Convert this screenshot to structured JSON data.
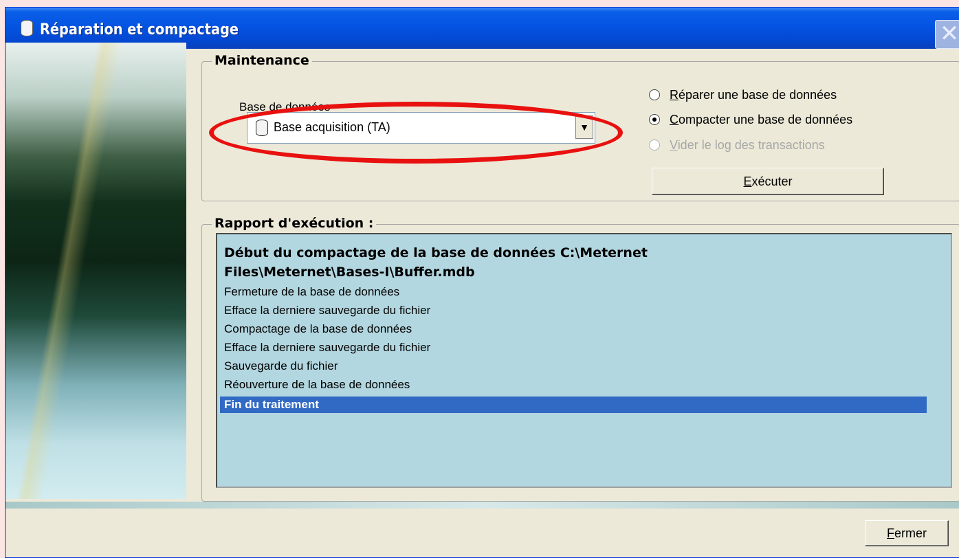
{
  "window": {
    "title": "Réparation et compactage",
    "close_glyph": "✕"
  },
  "maintenance": {
    "group_label": "Maintenance",
    "db_label": "Base de données",
    "selected_db": "Base acquisition (TA)",
    "dropdown_arrow": "▼",
    "options": [
      {
        "key": "R",
        "rest": "éparer une base de données",
        "checked": false,
        "enabled": true
      },
      {
        "key": "C",
        "rest": "ompacter une base de données",
        "checked": true,
        "enabled": true
      },
      {
        "key": "V",
        "rest": "ider le log des transactions",
        "checked": false,
        "enabled": false
      }
    ],
    "execute_key": "E",
    "execute_rest": "xécuter"
  },
  "report": {
    "group_label": "Rapport d'exécution :",
    "lines": [
      "Début du compactage de la base de données C:\\Meternet",
      "Files\\Meternet\\Bases-I\\Buffer.mdb",
      "Fermeture de la base de données",
      "Efface la derniere sauvegarde du fichier",
      "Compactage de la base de données",
      "Efface la derniere sauvegarde du fichier",
      "Sauvegarde du fichier",
      "Réouverture de la base de données",
      "Fin du traitement"
    ]
  },
  "footer": {
    "close_key": "F",
    "close_rest": "ermer"
  },
  "annotation": {
    "color": "#e8110f"
  },
  "icons": [
    "database-icon",
    "close-icon",
    "dropdown-arrow-icon",
    "database-icon"
  ]
}
